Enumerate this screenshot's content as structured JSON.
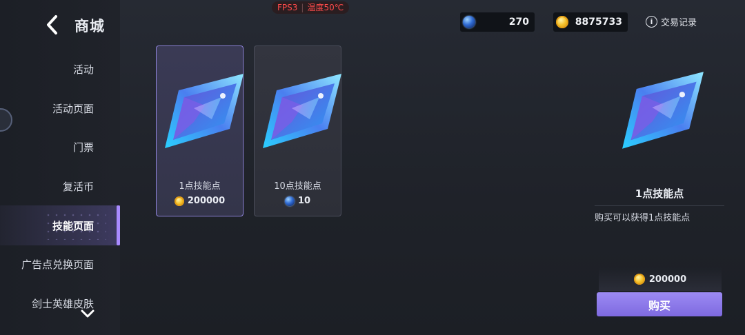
{
  "header": {
    "title": "商城"
  },
  "sidebar": {
    "items": [
      {
        "label": "活动"
      },
      {
        "label": "活动页面"
      },
      {
        "label": "门票"
      },
      {
        "label": "复活币"
      },
      {
        "label": "技能页面",
        "active": true
      },
      {
        "label": "广告点兑换页面"
      },
      {
        "label": "剑士英雄皮肤"
      }
    ]
  },
  "status": {
    "fps": "FPS3",
    "temperature": "温度50℃"
  },
  "currencies": {
    "orbs": {
      "icon": "blue-orb-icon",
      "value": "270"
    },
    "coins": {
      "icon": "gold-coin-icon",
      "value": "8875733"
    }
  },
  "history": {
    "label": "交易记录"
  },
  "products": [
    {
      "name": "1点技能点",
      "price": "200000",
      "currency_icon": "gold-coin-icon",
      "selected": true
    },
    {
      "name": "10点技能点",
      "price": "10",
      "currency_icon": "blue-orb-icon",
      "selected": false
    }
  ],
  "detail": {
    "name": "1点技能点",
    "description": "购买可以获得1点技能点",
    "price": "200000",
    "buy_label": "购买"
  },
  "colors": {
    "accent": "#8f7cec",
    "active_bar": "#a98bff",
    "fps_text": "#ff4b4b"
  }
}
